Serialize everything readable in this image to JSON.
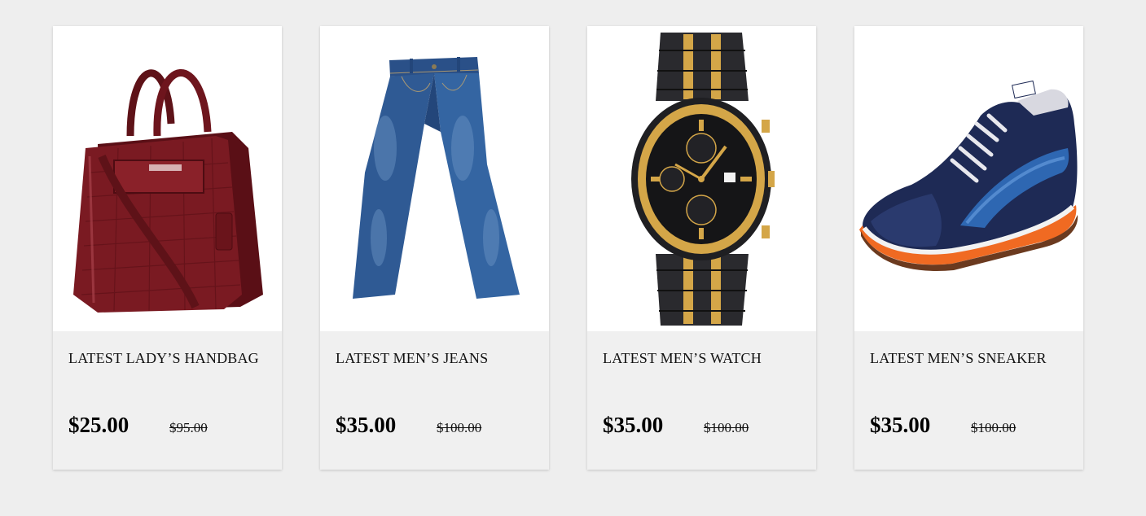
{
  "products": [
    {
      "title": "LATEST LADY’S HANDBAG",
      "price": "$25.00",
      "old_price": "$95.00",
      "image": "handbag-image"
    },
    {
      "title": "LATEST MEN’S JEANS",
      "price": "$35.00",
      "old_price": "$100.00",
      "image": "jeans-image"
    },
    {
      "title": "LATEST MEN’S WATCH",
      "price": "$35.00",
      "old_price": "$100.00",
      "image": "watch-image"
    },
    {
      "title": "LATEST MEN’S SNEAKER",
      "price": "$35.00",
      "old_price": "$100.00",
      "image": "sneaker-image"
    }
  ],
  "colors": {
    "page_background": "#eeeeee",
    "card_background": "#f0f0f0",
    "image_background": "#ffffff",
    "handbag": "#7a1a22",
    "jeans": "#2f5a94",
    "watch_gold": "#d4a648",
    "watch_dark": "#2a2a2e",
    "sneaker_navy": "#1e2a55",
    "sneaker_orange": "#f06a22"
  }
}
